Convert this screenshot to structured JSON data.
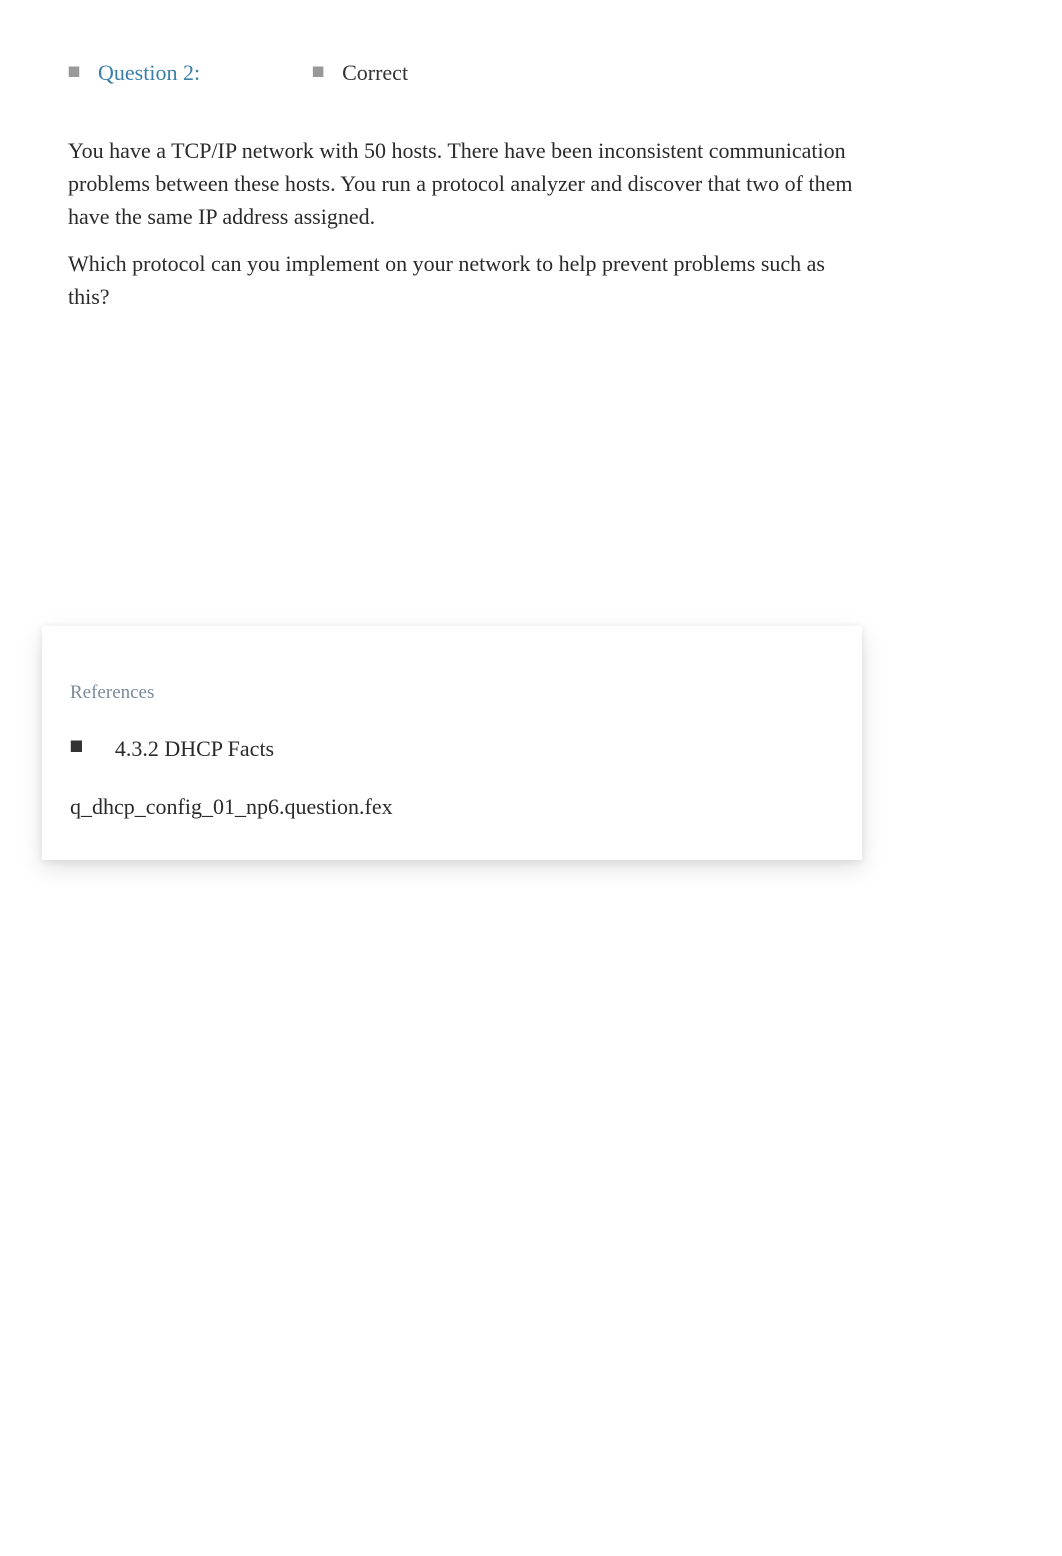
{
  "question": {
    "label": "Question 2:",
    "status": "Correct",
    "body_p1": "You have a TCP/IP network with 50 hosts. There have been inconsistent communication problems between these hosts. You run a protocol analyzer and discover that two of them have the same IP address assigned.",
    "body_p2": "Which protocol can you implement on your network to help prevent problems such as this?"
  },
  "references": {
    "title": "References",
    "items": [
      {
        "text": "4.3.2 DHCP Facts"
      }
    ],
    "file": "q_dhcp_config_01_np6.question.fex"
  }
}
